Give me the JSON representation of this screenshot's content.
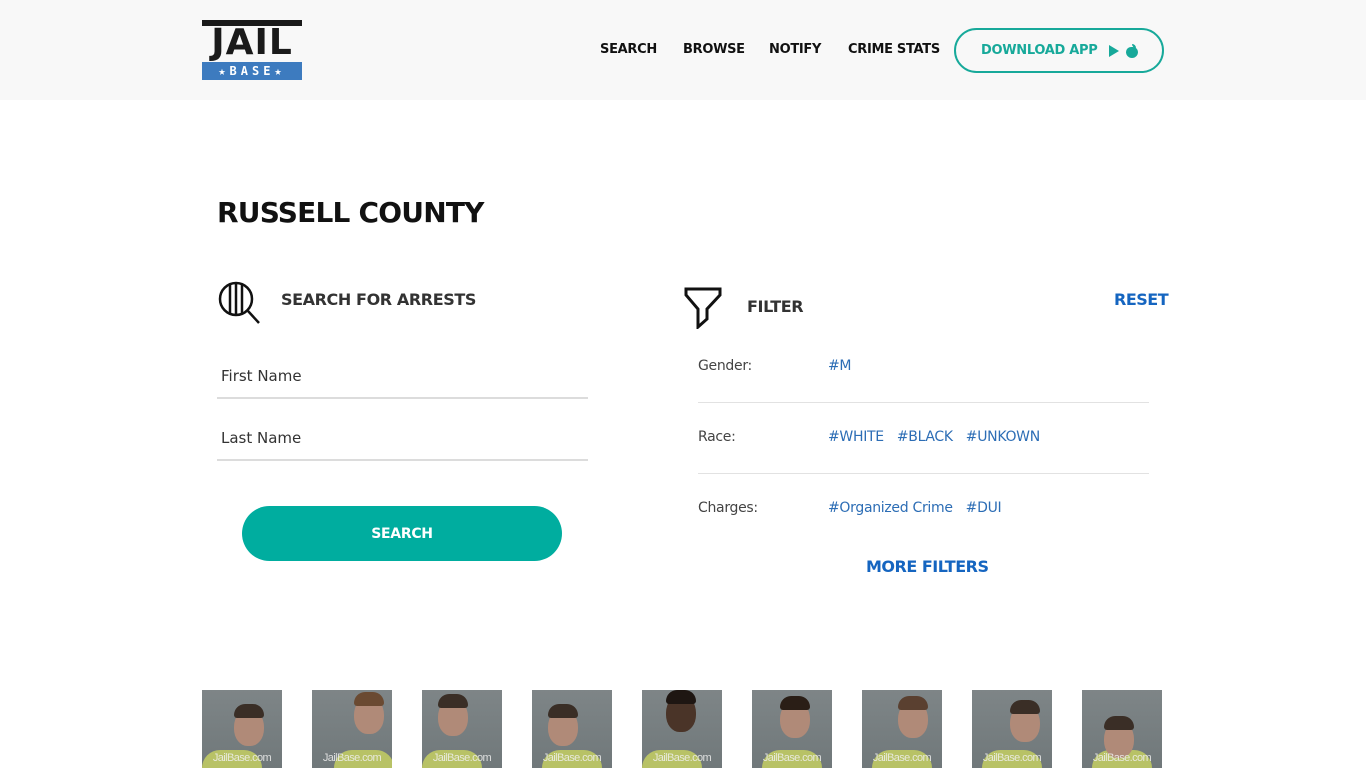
{
  "header": {
    "logo": {
      "top": "JAIL",
      "bottom": "★BASE★"
    },
    "nav": [
      "SEARCH",
      "BROWSE",
      "NOTIFY",
      "CRIME STATS"
    ],
    "download_label": "DOWNLOAD APP",
    "download_icons": [
      "google-play-icon",
      "apple-icon"
    ]
  },
  "page": {
    "title": "RUSSELL COUNTY"
  },
  "search": {
    "heading": "SEARCH FOR ARRESTS",
    "first_name_placeholder": "First Name",
    "first_name_value": "",
    "last_name_placeholder": "Last Name",
    "last_name_value": "",
    "button_label": "SEARCH"
  },
  "filter": {
    "heading": "FILTER",
    "reset_label": "RESET",
    "rows": [
      {
        "label": "Gender:",
        "tags": [
          "#M"
        ]
      },
      {
        "label": "Race:",
        "tags": [
          "#WHITE",
          "#BLACK",
          "#UNKOWN"
        ]
      },
      {
        "label": "Charges:",
        "tags": [
          "#Organized Crime",
          "#DUI"
        ]
      }
    ],
    "more_label": "MORE FILTERS"
  },
  "mugshots": {
    "watermark": "JailBase.com",
    "count": 9
  },
  "colors": {
    "accent_teal": "#00ad9f",
    "link_blue": "#1565c0",
    "logo_blue": "#3d7bbf",
    "header_bg": "#f8f8f8"
  }
}
